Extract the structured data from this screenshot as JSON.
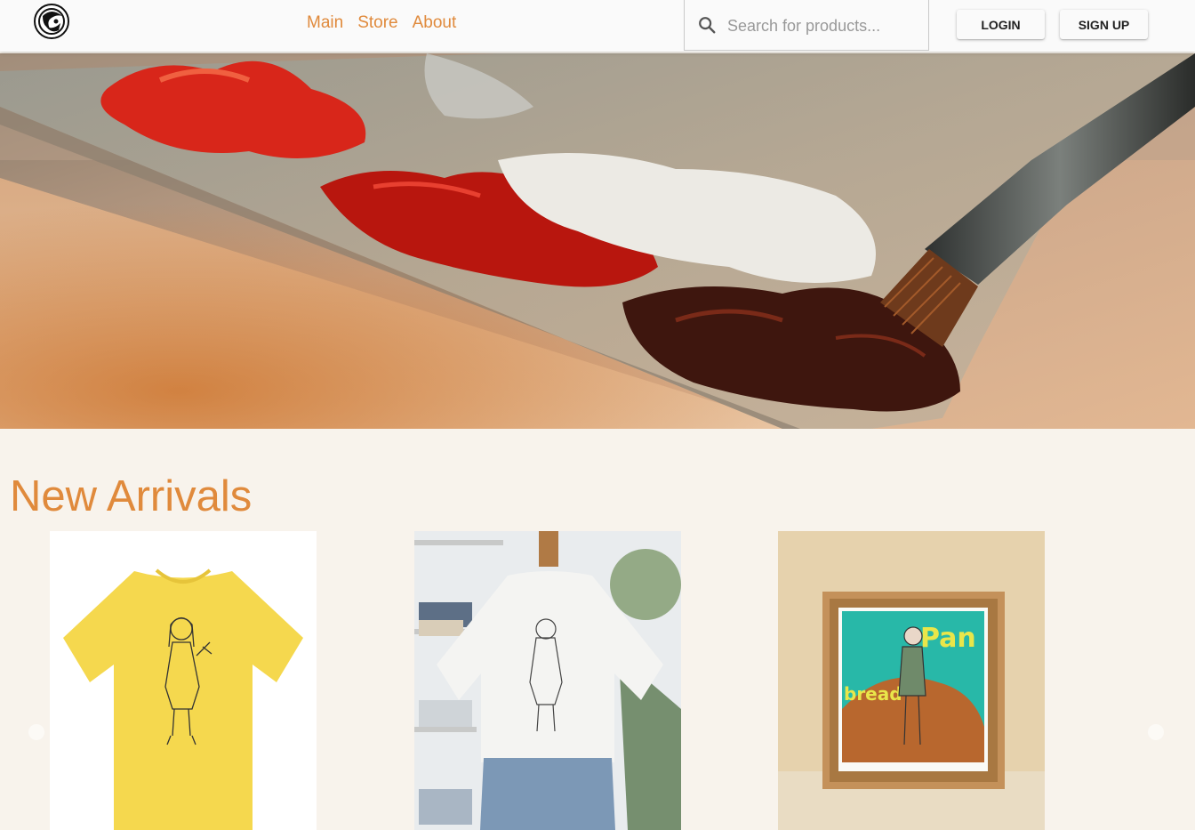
{
  "header": {
    "logo_icon": "brand-logo-icon",
    "nav": [
      "Main",
      "Store",
      "About"
    ],
    "search": {
      "placeholder": "Search for products...",
      "value": "",
      "icon": "search-icon"
    },
    "login_label": "LOGIN",
    "signup_label": "SIGN UP"
  },
  "hero": {
    "image": "paint-palette-with-brush"
  },
  "new_arrivals": {
    "title": "New Arrivals",
    "items": [
      {
        "image": "yellow-tshirt-with-anime-girl-line-art"
      },
      {
        "image": "white-tshirt-on-mannequin"
      },
      {
        "image": "framed-anime-girl-print"
      }
    ]
  },
  "colors": {
    "accent": "#e08a3c",
    "background": "#f8f3ec",
    "header_bg": "#fafafa"
  }
}
